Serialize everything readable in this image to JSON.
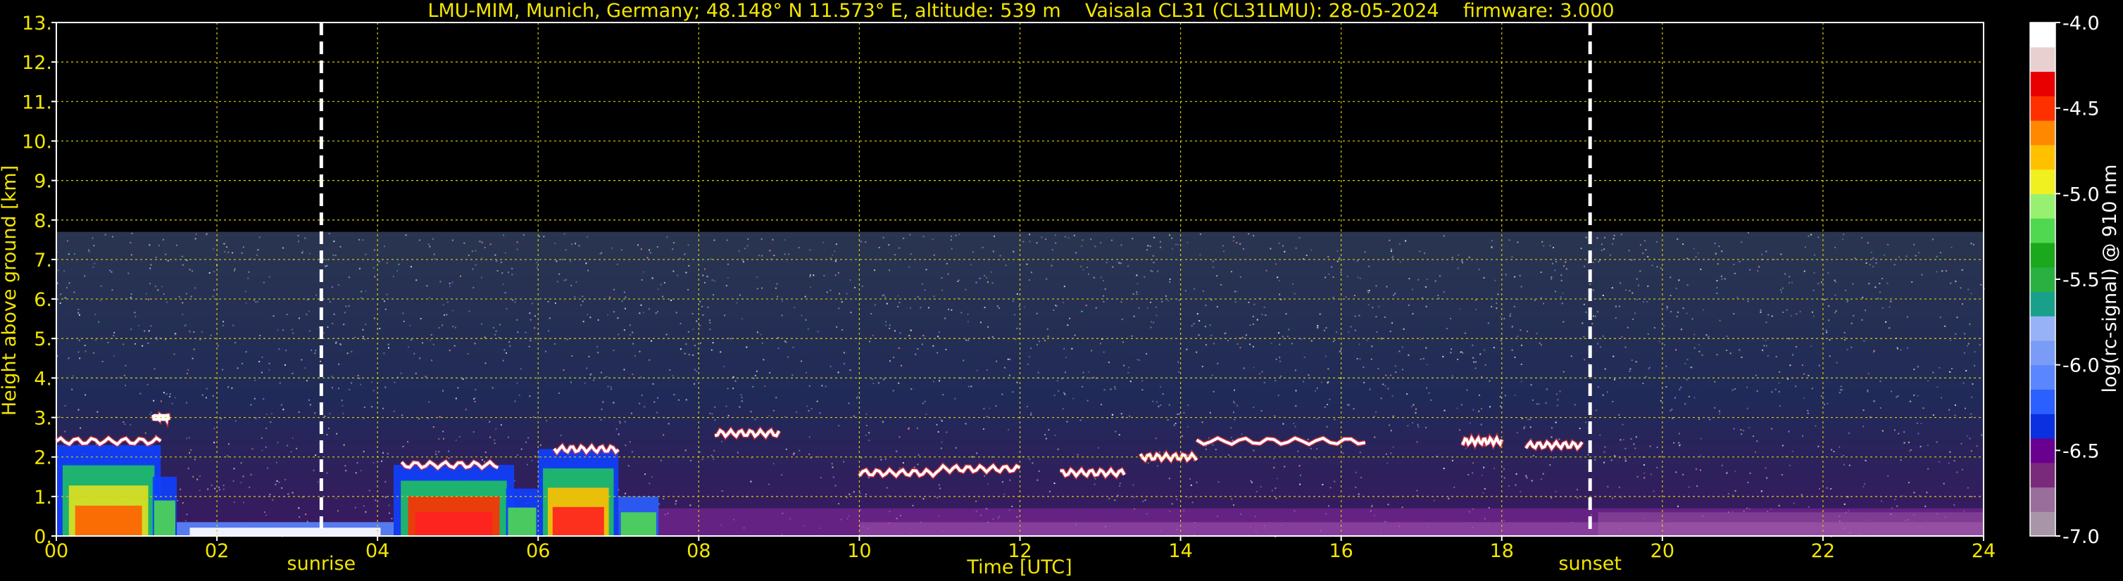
{
  "chart_data": {
    "type": "heatmap",
    "title": "LMU-MIM, Munich, Germany; 48.148° N 11.573° E, altitude: 539 m    Vaisala CL31 (CL31LMU): 28-05-2024    firmware: 3.000",
    "xlabel": "Time [UTC]",
    "ylabel": "Height above ground [km]",
    "colorbar_label": "log(rc-signal) @ 910 nm",
    "xlim": [
      0,
      24
    ],
    "ylim": [
      0,
      13
    ],
    "x_ticks": [
      "00",
      "02",
      "04",
      "06",
      "08",
      "10",
      "12",
      "14",
      "16",
      "18",
      "20",
      "22",
      "24"
    ],
    "y_ticks": [
      "0.",
      "1.",
      "2.",
      "3.",
      "4.",
      "5.",
      "6.",
      "7.",
      "8.",
      "9.",
      "10.",
      "11.",
      "12.",
      "13."
    ],
    "colorbar_ticks": [
      "-4.0",
      "-4.5",
      "-5.0",
      "-5.5",
      "-6.0",
      "-6.5",
      "-7.0"
    ],
    "colorbar_range": [
      -7.0,
      -4.0
    ],
    "grid": true,
    "markers": [
      {
        "label": "sunrise",
        "time": 3.3
      },
      {
        "label": "sunset",
        "time": 19.1
      }
    ],
    "data_top_km": 7.7,
    "cloud_layers": [
      {
        "start": 0.0,
        "end": 1.3,
        "height_km": 2.4
      },
      {
        "start": 1.2,
        "end": 1.4,
        "height_km": 3.0
      },
      {
        "start": 4.3,
        "end": 5.5,
        "height_km": 1.8
      },
      {
        "start": 6.2,
        "end": 7.0,
        "height_km": 2.2
      },
      {
        "start": 8.2,
        "end": 9.0,
        "height_km": 2.6
      },
      {
        "start": 10.0,
        "end": 11.0,
        "height_km": 1.6
      },
      {
        "start": 11.0,
        "end": 12.0,
        "height_km": 1.7
      },
      {
        "start": 12.5,
        "end": 13.3,
        "height_km": 1.6
      },
      {
        "start": 13.5,
        "end": 14.2,
        "height_km": 2.0
      },
      {
        "start": 14.2,
        "end": 16.3,
        "height_km": 2.4
      },
      {
        "start": 17.5,
        "end": 18.0,
        "height_km": 2.4
      },
      {
        "start": 18.3,
        "end": 19.0,
        "height_km": 2.3
      }
    ],
    "colorscale": [
      "#a896a8",
      "#9a6e9a",
      "#7a2a7a",
      "#6a0090",
      "#0a30e0",
      "#2a60ff",
      "#5a86ff",
      "#7a9cf6",
      "#98b2f8",
      "#18a08a",
      "#2ab040",
      "#1ca81c",
      "#50d850",
      "#98f070",
      "#f0f020",
      "#ffc000",
      "#ff8800",
      "#ff3000",
      "#e80000",
      "#e8d0d0",
      "#ffffff"
    ]
  }
}
